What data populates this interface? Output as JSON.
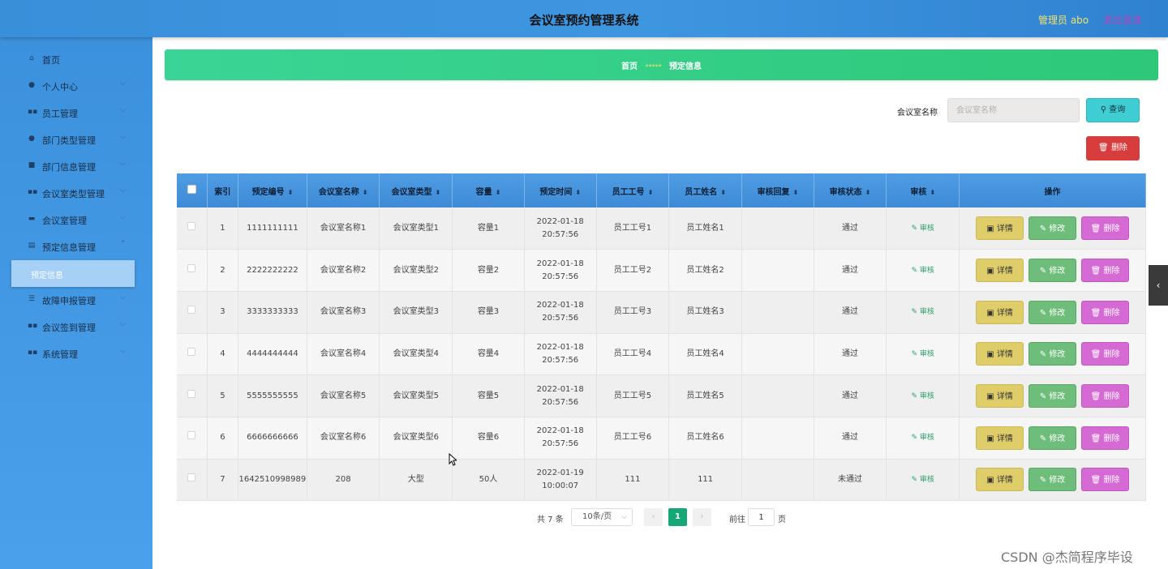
{
  "header": {
    "title": "会议室预约管理系统",
    "admin": "管理员 abo",
    "logout": "退出登录"
  },
  "sidebar": {
    "items": [
      {
        "label": "首页",
        "icon": "home-icon",
        "has_arrow": false
      },
      {
        "label": "个人中心",
        "icon": "user-icon",
        "has_arrow": true
      },
      {
        "label": "员工管理",
        "icon": "grid-icon",
        "has_arrow": true
      },
      {
        "label": "部门类型管理",
        "icon": "user-icon",
        "has_arrow": true
      },
      {
        "label": "部门信息管理",
        "icon": "briefcase-icon",
        "has_arrow": true
      },
      {
        "label": "会议室类型管理",
        "icon": "grid-icon",
        "has_arrow": true
      },
      {
        "label": "会议室管理",
        "icon": "monitor-icon",
        "has_arrow": true
      },
      {
        "label": "预定信息管理",
        "icon": "document-icon",
        "has_arrow": true
      },
      {
        "label": "故障申报管理",
        "icon": "list-icon",
        "has_arrow": true
      },
      {
        "label": "会议签到管理",
        "icon": "grid-icon",
        "has_arrow": true
      },
      {
        "label": "系统管理",
        "icon": "grid-icon",
        "has_arrow": true
      }
    ],
    "active_sub": "预定信息"
  },
  "breadcrumb": {
    "home": "首页",
    "separator": "*****",
    "current": "预定信息"
  },
  "search": {
    "label": "会议室名称",
    "placeholder": "会议室名称",
    "button": "查询"
  },
  "toolbar": {
    "delete": "删除"
  },
  "table": {
    "headers": [
      "索引",
      "预定编号",
      "会议室名称",
      "会议室类型",
      "容量",
      "预定时间",
      "员工工号",
      "员工姓名",
      "审核回复",
      "审核状态",
      "审核",
      "操作"
    ],
    "rows": [
      {
        "index": "1",
        "code": "1111111111",
        "room": "会议室名称1",
        "type": "会议室类型1",
        "capacity": "容量1",
        "time": "2022-01-18 20:57:56",
        "emp_no": "员工工号1",
        "emp_name": "员工姓名1",
        "reply": "",
        "status": "通过"
      },
      {
        "index": "2",
        "code": "2222222222",
        "room": "会议室名称2",
        "type": "会议室类型2",
        "capacity": "容量2",
        "time": "2022-01-18 20:57:56",
        "emp_no": "员工工号2",
        "emp_name": "员工姓名2",
        "reply": "",
        "status": "通过"
      },
      {
        "index": "3",
        "code": "3333333333",
        "room": "会议室名称3",
        "type": "会议室类型3",
        "capacity": "容量3",
        "time": "2022-01-18 20:57:56",
        "emp_no": "员工工号3",
        "emp_name": "员工姓名3",
        "reply": "",
        "status": "通过"
      },
      {
        "index": "4",
        "code": "4444444444",
        "room": "会议室名称4",
        "type": "会议室类型4",
        "capacity": "容量4",
        "time": "2022-01-18 20:57:56",
        "emp_no": "员工工号4",
        "emp_name": "员工姓名4",
        "reply": "",
        "status": "通过"
      },
      {
        "index": "5",
        "code": "5555555555",
        "room": "会议室名称5",
        "type": "会议室类型5",
        "capacity": "容量5",
        "time": "2022-01-18 20:57:56",
        "emp_no": "员工工号5",
        "emp_name": "员工姓名5",
        "reply": "",
        "status": "通过"
      },
      {
        "index": "6",
        "code": "6666666666",
        "room": "会议室名称6",
        "type": "会议室类型6",
        "capacity": "容量6",
        "time": "2022-01-18 20:57:56",
        "emp_no": "员工工号6",
        "emp_name": "员工姓名6",
        "reply": "",
        "status": "通过"
      },
      {
        "index": "7",
        "code": "1642510998989",
        "room": "208",
        "type": "大型",
        "capacity": "50人",
        "time": "2022-01-19 10:00:07",
        "emp_no": "111",
        "emp_name": "111",
        "reply": "",
        "status": "未通过"
      }
    ],
    "audit_label": "审核",
    "actions": {
      "detail": "详情",
      "edit": "修改",
      "delete": "删除"
    }
  },
  "pagination": {
    "total": "共 7 条",
    "page_size": "10条/页",
    "current": "1",
    "goto_label": "前往",
    "goto_value": "1",
    "page_unit": "页"
  },
  "watermark": "CSDN @杰简程序毕设",
  "colors": {
    "header": "#3a8fd9",
    "sidebar": "#4aa0ea",
    "breadcrumb": "#2ec878",
    "detail_button": "#dfcd6a",
    "edit_button": "#6fbd7a",
    "delete_button": "#d66ad4",
    "danger_button": "#d73d3d",
    "search_button": "#3fcdd4",
    "pagination_active": "#15a876"
  }
}
